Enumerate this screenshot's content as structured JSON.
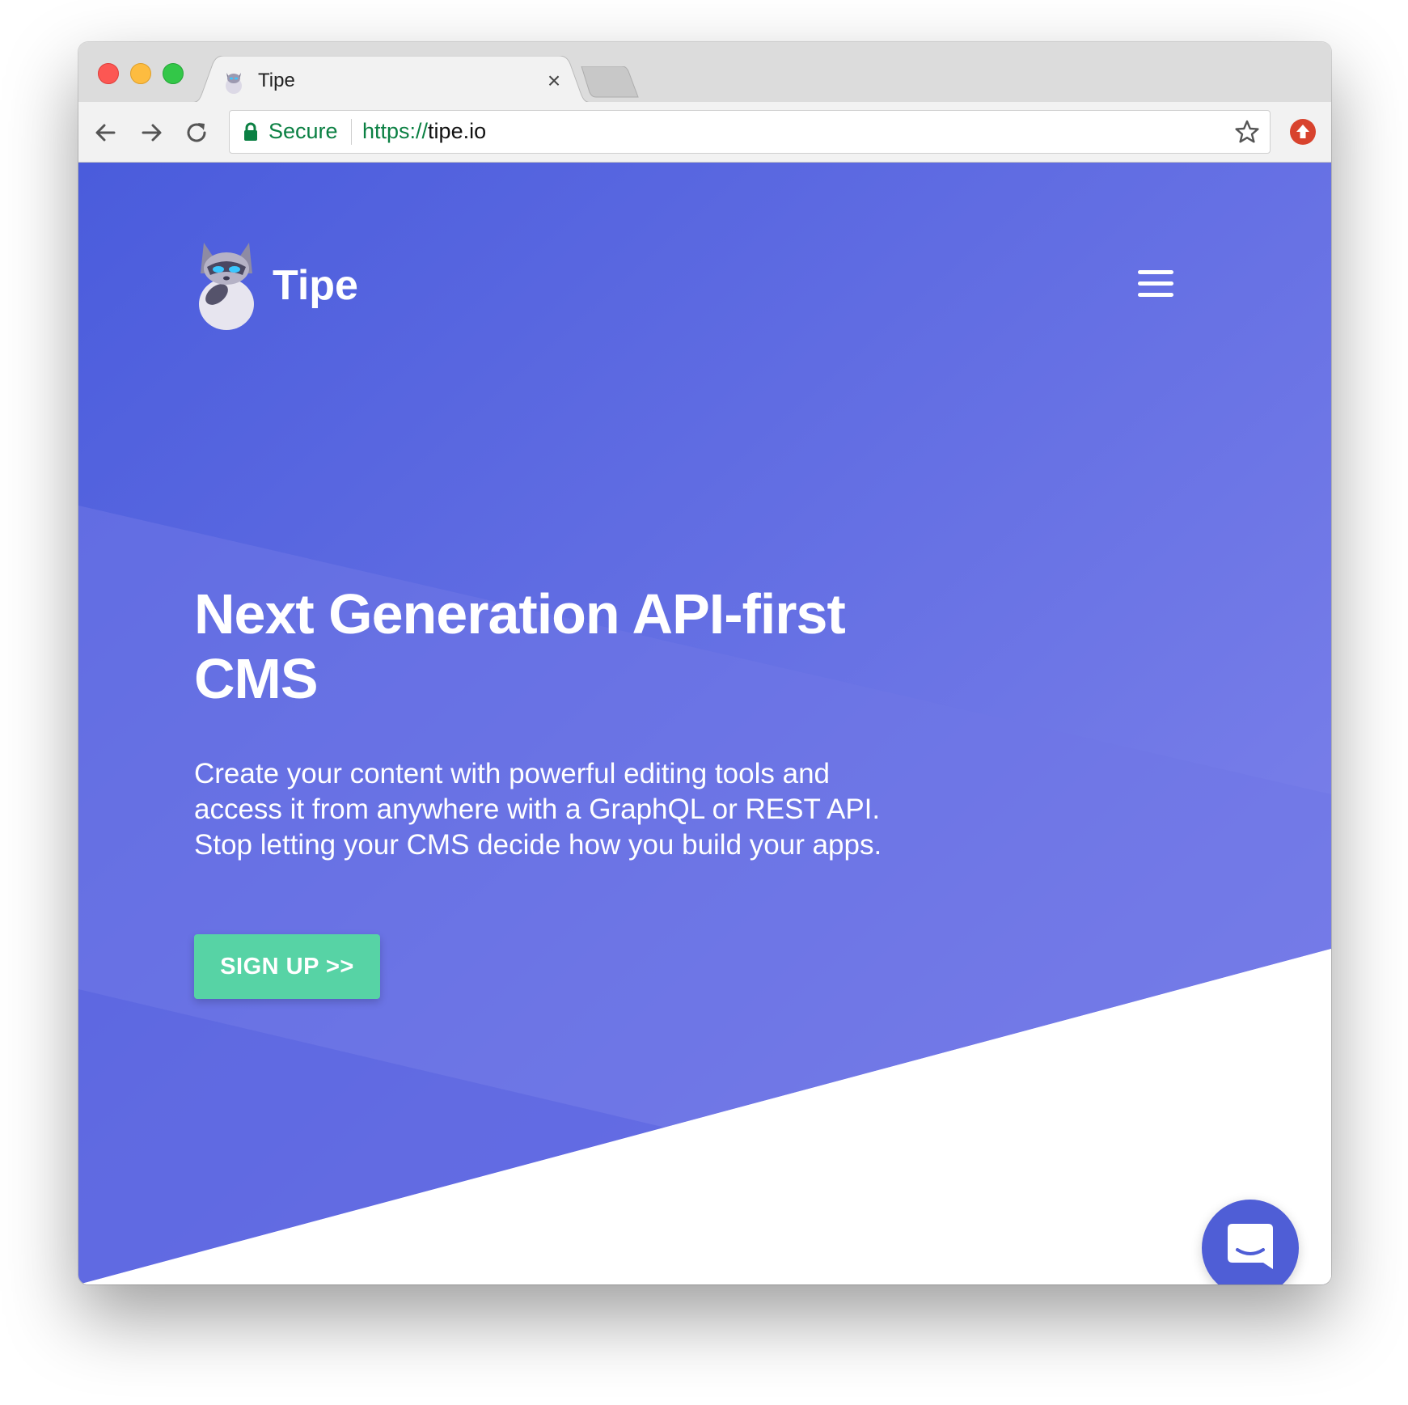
{
  "browser": {
    "tab_title": "Tipe",
    "tab_close": "×",
    "secure_label": "Secure",
    "url_scheme": "https://",
    "url_host": "tipe.io",
    "icons": {
      "back": "arrow-left-icon",
      "forward": "arrow-right-icon",
      "reload": "reload-icon",
      "lock": "lock-icon",
      "bookmark": "star-icon",
      "extension": "upload-arrow-icon"
    }
  },
  "page": {
    "brand": "Tipe",
    "headline_line1": "Next Generation API-first",
    "headline_line2": "CMS",
    "subtext_line1": "Create your content with powerful editing tools and",
    "subtext_line2": "access it from anywhere with a GraphQL or REST API.",
    "subtext_line3": "Stop letting your CMS decide how you build your apps.",
    "cta_label": "SIGN UP >>",
    "menu_icon": "hamburger-menu-icon",
    "chat_icon": "chat-icon"
  },
  "colors": {
    "hero_start": "#4a5cdc",
    "hero_end": "#8386ec",
    "cta": "#57d3a5",
    "chat_button": "#4f5ed6",
    "secure_green": "#0b8043"
  }
}
